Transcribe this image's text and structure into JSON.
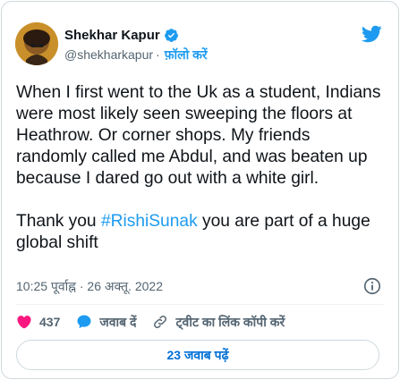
{
  "author": {
    "name": "Shekhar Kapur",
    "handle": "@shekharkapur",
    "separator": "·",
    "follow_label": "फ़ॉलो करें"
  },
  "tweet": {
    "text_before_hashtag": "When I first went to the Uk as a student, Indians were most likely seen sweeping the floors at Heathrow. Or corner shops. My friends randomly called me Abdul, and was beaten up because I dared go out with a white girl.\n\nThank you ",
    "hashtag": "#RishiSunak",
    "text_after_hashtag": " you are part of a huge global shift"
  },
  "meta": {
    "timestamp": "10:25 पूर्वाह्न · 26 अक्तू. 2022"
  },
  "actions": {
    "like_count": "437",
    "reply_label": "जवाब दें",
    "copy_link_label": "ट्वीट का लिंक कॉपी करें"
  },
  "replies_button": {
    "label": "23 जवाब पढ़ें"
  },
  "colors": {
    "accent": "#1d9bf0",
    "like": "#f91880",
    "text": "#0f1419",
    "muted": "#536471"
  },
  "icons": [
    "verified-badge-icon",
    "twitter-bird-icon",
    "info-icon",
    "heart-icon",
    "reply-bubble-icon",
    "link-icon"
  ]
}
